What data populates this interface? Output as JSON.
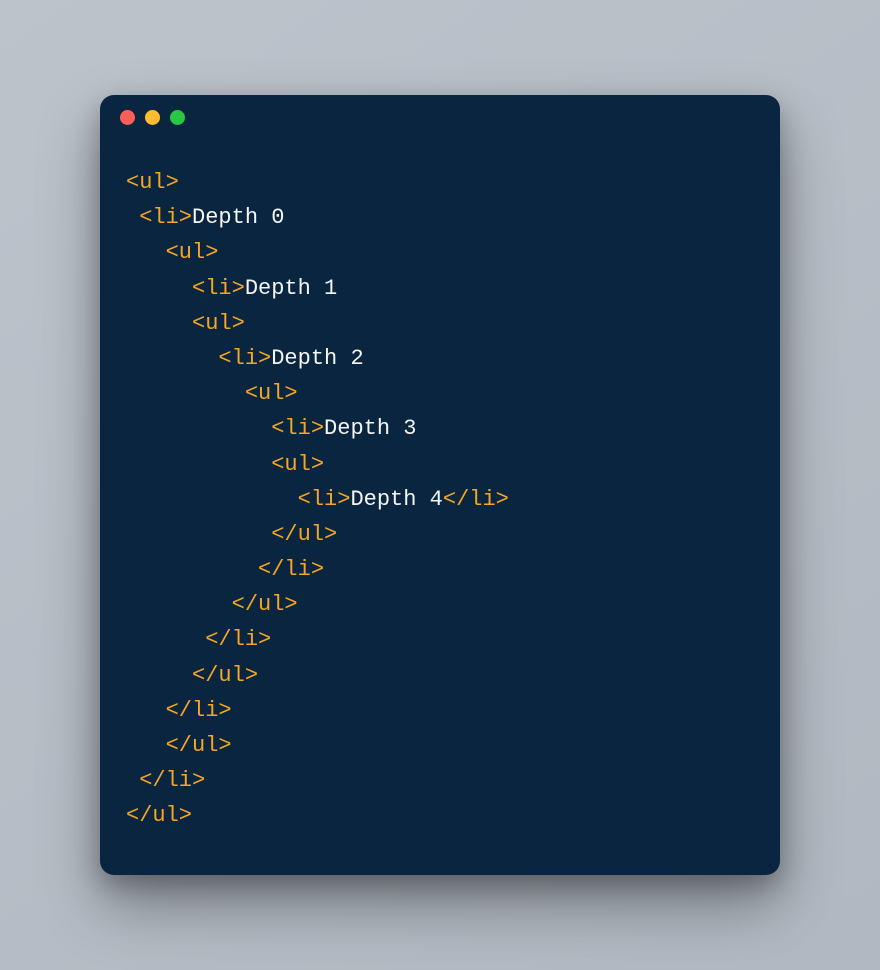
{
  "traffic_lights": {
    "red": "#ff5f57",
    "yellow": "#febc2e",
    "green": "#28c840"
  },
  "colors": {
    "window_bg": "#0a2540",
    "tag": "#f5a623",
    "text": "#f5f5f5"
  },
  "code": {
    "lines": [
      {
        "indent": "",
        "segments": [
          {
            "t": "tag",
            "v": "<ul>"
          }
        ]
      },
      {
        "indent": " ",
        "segments": [
          {
            "t": "tag",
            "v": "<li>"
          },
          {
            "t": "text",
            "v": "Depth 0"
          }
        ]
      },
      {
        "indent": "   ",
        "segments": [
          {
            "t": "tag",
            "v": "<ul>"
          }
        ]
      },
      {
        "indent": "     ",
        "segments": [
          {
            "t": "tag",
            "v": "<li>"
          },
          {
            "t": "text",
            "v": "Depth 1"
          }
        ]
      },
      {
        "indent": "     ",
        "segments": [
          {
            "t": "tag",
            "v": "<ul>"
          }
        ]
      },
      {
        "indent": "       ",
        "segments": [
          {
            "t": "tag",
            "v": "<li>"
          },
          {
            "t": "text",
            "v": "Depth 2"
          }
        ]
      },
      {
        "indent": "         ",
        "segments": [
          {
            "t": "tag",
            "v": "<ul>"
          }
        ]
      },
      {
        "indent": "           ",
        "segments": [
          {
            "t": "tag",
            "v": "<li>"
          },
          {
            "t": "text",
            "v": "Depth 3"
          }
        ]
      },
      {
        "indent": "           ",
        "segments": [
          {
            "t": "tag",
            "v": "<ul>"
          }
        ]
      },
      {
        "indent": "             ",
        "segments": [
          {
            "t": "tag",
            "v": "<li>"
          },
          {
            "t": "text",
            "v": "Depth 4"
          },
          {
            "t": "tag",
            "v": "</li>"
          }
        ]
      },
      {
        "indent": "           ",
        "segments": [
          {
            "t": "tag",
            "v": "</ul>"
          }
        ]
      },
      {
        "indent": "          ",
        "segments": [
          {
            "t": "tag",
            "v": "</li>"
          }
        ]
      },
      {
        "indent": "        ",
        "segments": [
          {
            "t": "tag",
            "v": "</ul>"
          }
        ]
      },
      {
        "indent": "      ",
        "segments": [
          {
            "t": "tag",
            "v": "</li>"
          }
        ]
      },
      {
        "indent": "     ",
        "segments": [
          {
            "t": "tag",
            "v": "</ul>"
          }
        ]
      },
      {
        "indent": "   ",
        "segments": [
          {
            "t": "tag",
            "v": "</li>"
          }
        ]
      },
      {
        "indent": "   ",
        "segments": [
          {
            "t": "tag",
            "v": "</ul>"
          }
        ]
      },
      {
        "indent": " ",
        "segments": [
          {
            "t": "tag",
            "v": "</li>"
          }
        ]
      },
      {
        "indent": "",
        "segments": [
          {
            "t": "tag",
            "v": "</ul>"
          }
        ]
      }
    ]
  }
}
